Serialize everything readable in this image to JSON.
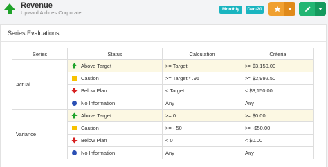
{
  "header": {
    "title": "Revenue",
    "subtitle": "Upward Airlines Corporate",
    "badge_frequency": "Monthly",
    "badge_date": "Dec-20"
  },
  "card": {
    "title": "Series Evaluations"
  },
  "table": {
    "headers": [
      "Series",
      "Status",
      "Calculation",
      "Criteria"
    ],
    "groups": [
      {
        "series": "Actual",
        "rows": [
          {
            "icon": "green-up-arrow-icon",
            "status": "Above Target",
            "calculation": ">= Target",
            "criteria": ">= $3,150.00"
          },
          {
            "icon": "yellow-square-icon",
            "status": "Caution",
            "calculation": ">= Target * .95",
            "criteria": ">= $2,992.50"
          },
          {
            "icon": "red-down-arrow-icon",
            "status": "Below Plan",
            "calculation": "< Target",
            "criteria": "< $3,150.00"
          },
          {
            "icon": "blue-circle-icon",
            "status": "No Information",
            "calculation": "Any",
            "criteria": "Any"
          }
        ]
      },
      {
        "series": "Variance",
        "rows": [
          {
            "icon": "green-up-arrow-icon",
            "status": "Above Target",
            "calculation": ">= 0",
            "criteria": ">= $0.00"
          },
          {
            "icon": "yellow-square-icon",
            "status": "Caution",
            "calculation": ">= - 50",
            "criteria": ">= -$50.00"
          },
          {
            "icon": "red-down-arrow-icon",
            "status": "Below Plan",
            "calculation": "< 0",
            "criteria": "< $0.00"
          },
          {
            "icon": "blue-circle-icon",
            "status": "No Information",
            "calculation": "Any",
            "criteria": "Any"
          }
        ]
      }
    ]
  },
  "colors": {
    "badge": "#1ab5c0",
    "star_button": "#f0a030",
    "edit_button": "#22b573",
    "highlight_row": "#fcf8e3",
    "up_arrow": "#1fa32a",
    "down_arrow": "#d62020",
    "caution": "#f8c200",
    "no_info": "#2a4fb4"
  }
}
